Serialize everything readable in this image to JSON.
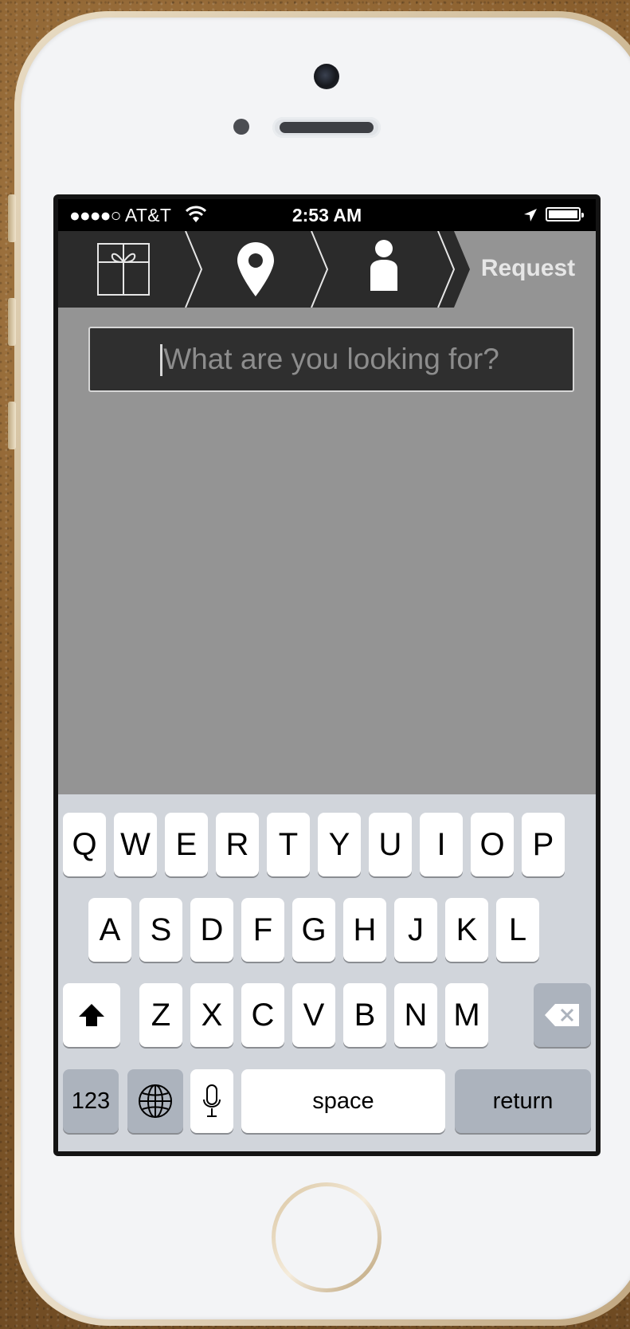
{
  "status_bar": {
    "signal": "●●●●○",
    "carrier": "AT&T",
    "time": "2:53 AM"
  },
  "steps": {
    "items": [
      {
        "icon": "gift-icon"
      },
      {
        "icon": "map-pin-icon"
      },
      {
        "icon": "person-icon"
      },
      {
        "label": "Request"
      }
    ]
  },
  "search": {
    "placeholder": "What are you looking for?",
    "value": ""
  },
  "keyboard": {
    "row1": [
      "Q",
      "W",
      "E",
      "R",
      "T",
      "Y",
      "U",
      "I",
      "O",
      "P"
    ],
    "row2": [
      "A",
      "S",
      "D",
      "F",
      "G",
      "H",
      "J",
      "K",
      "L"
    ],
    "row3": [
      "Z",
      "X",
      "C",
      "V",
      "B",
      "N",
      "M"
    ],
    "numbers_label": "123",
    "space_label": "space",
    "return_label": "return",
    "shift_icon": "shift-icon",
    "delete_icon": "delete-icon",
    "globe_icon": "globe-icon",
    "mic_icon": "microphone-icon"
  },
  "colors": {
    "stepbar": "#2b2b2b",
    "content_bg": "#949494",
    "keyboard_bg": "#d1d5db"
  }
}
